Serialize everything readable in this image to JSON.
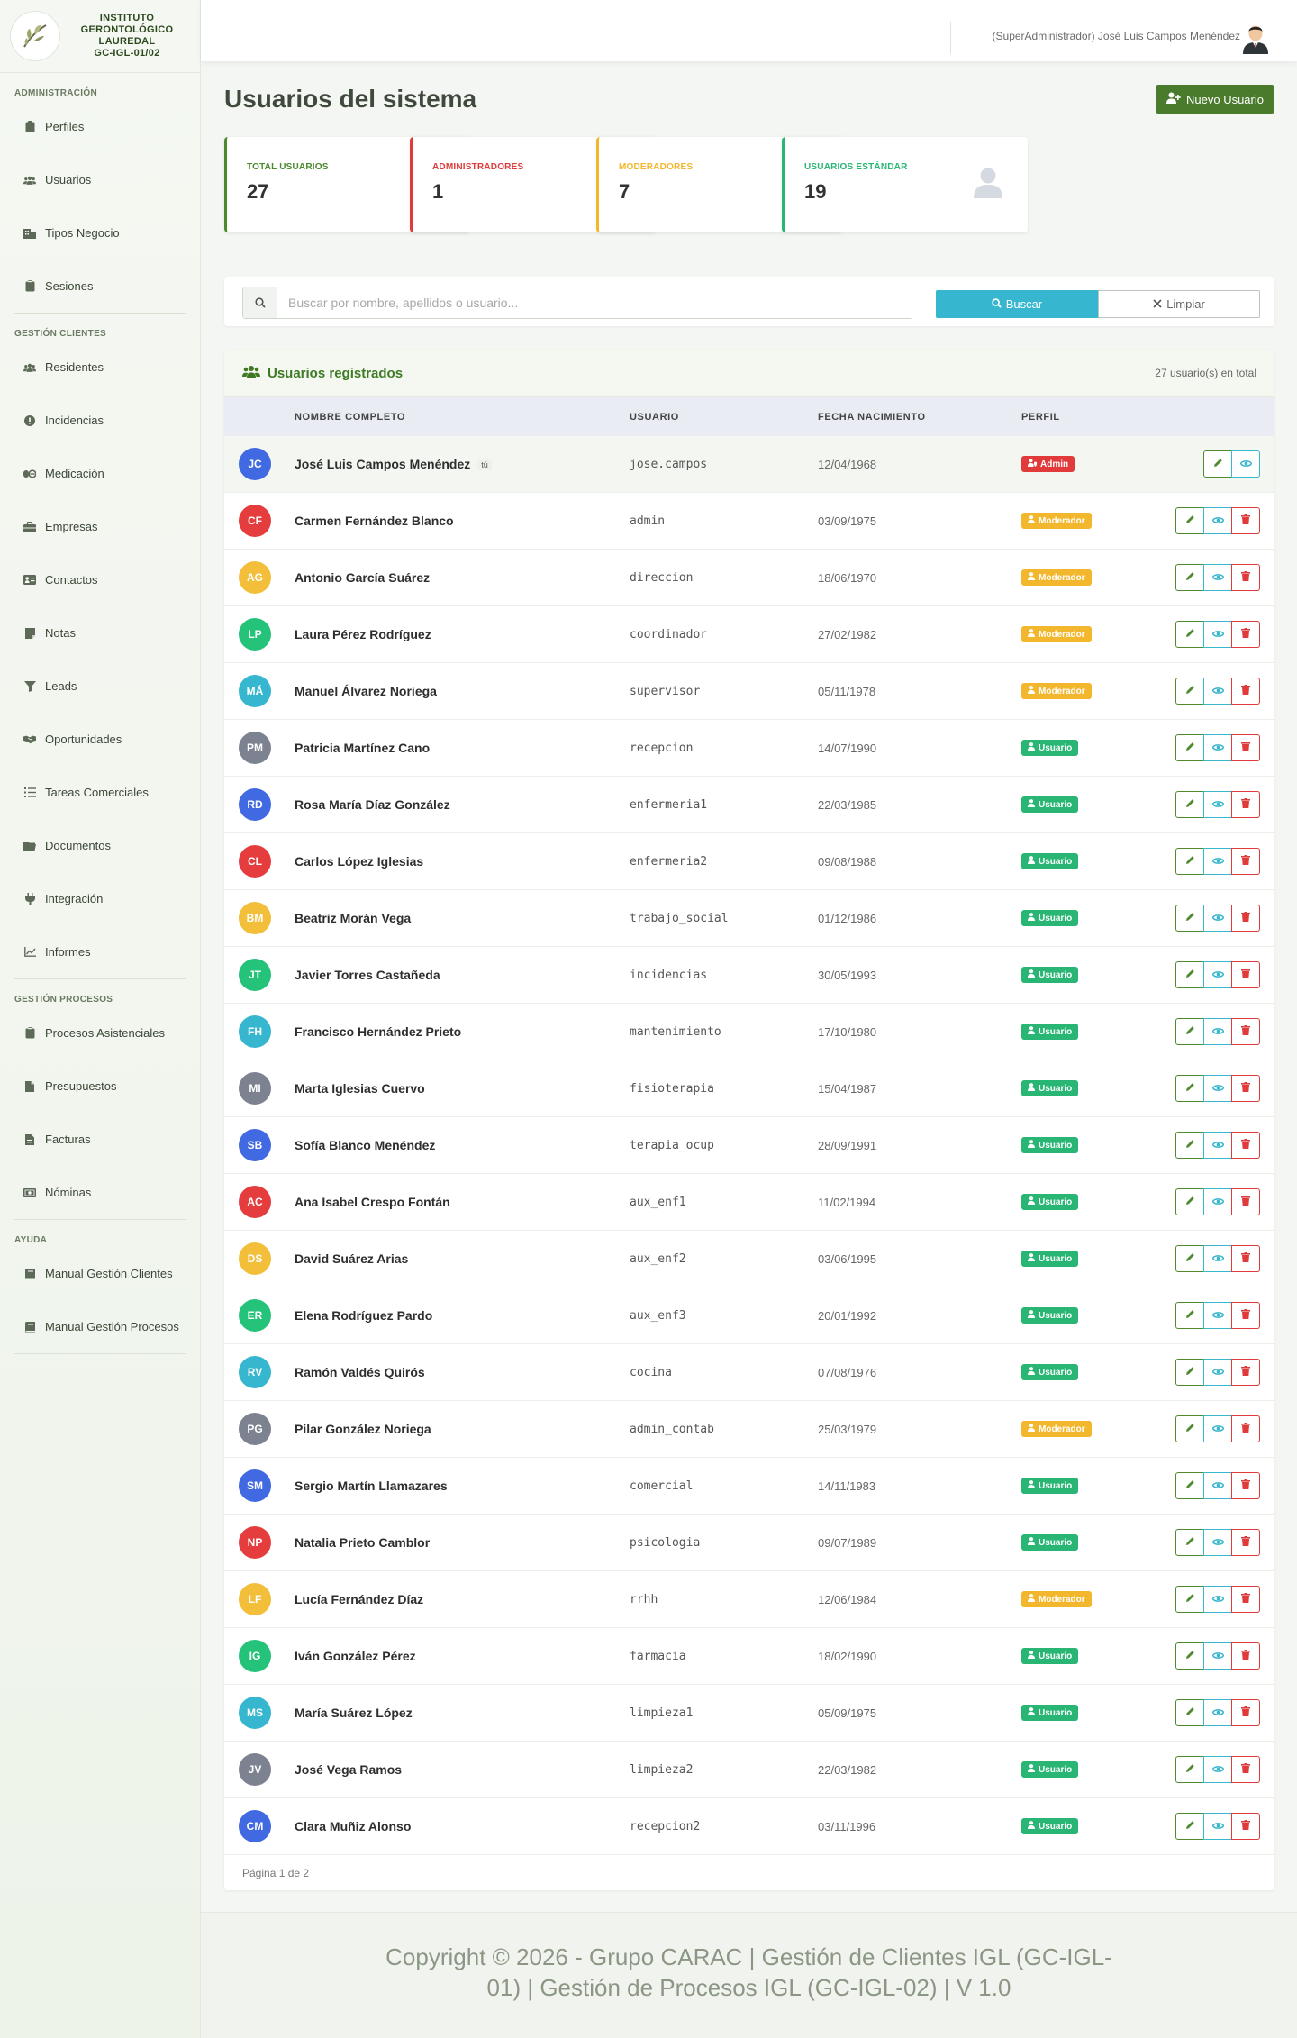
{
  "brand": {
    "line1": "INSTITUTO",
    "line2": "GERONTOLÓGICO",
    "line3": "LAUREDAL",
    "line4": "GC-IGL-01/02"
  },
  "sidebar": {
    "sections": [
      {
        "title": "ADMINISTRACIÓN",
        "items": [
          {
            "label": "Perfiles",
            "icon": "id-badge-icon"
          },
          {
            "label": "Usuarios",
            "icon": "users-icon"
          },
          {
            "label": "Tipos Negocio",
            "icon": "building-icon"
          },
          {
            "label": "Sesiones",
            "icon": "clipboard-icon"
          }
        ]
      },
      {
        "title": "GESTIÓN CLIENTES",
        "items": [
          {
            "label": "Residentes",
            "icon": "users-icon"
          },
          {
            "label": "Incidencias",
            "icon": "alert-icon"
          },
          {
            "label": "Medicación",
            "icon": "pills-icon"
          },
          {
            "label": "Empresas",
            "icon": "briefcase-icon"
          },
          {
            "label": "Contactos",
            "icon": "address-card-icon"
          },
          {
            "label": "Notas",
            "icon": "note-icon"
          },
          {
            "label": "Leads",
            "icon": "funnel-icon"
          },
          {
            "label": "Oportunidades",
            "icon": "handshake-icon"
          },
          {
            "label": "Tareas Comerciales",
            "icon": "list-icon"
          },
          {
            "label": "Documentos",
            "icon": "folder-icon"
          },
          {
            "label": "Integración",
            "icon": "plug-icon"
          },
          {
            "label": "Informes",
            "icon": "chart-icon"
          }
        ]
      },
      {
        "title": "GESTIÓN PROCESOS",
        "items": [
          {
            "label": "Procesos Asistenciales",
            "icon": "clipboard-icon"
          },
          {
            "label": "Presupuestos",
            "icon": "file-icon"
          },
          {
            "label": "Facturas",
            "icon": "invoice-icon"
          },
          {
            "label": "Nóminas",
            "icon": "money-icon"
          }
        ]
      },
      {
        "title": "AYUDA",
        "items": [
          {
            "label": "Manual Gestión Clientes",
            "icon": "book-icon"
          },
          {
            "label": "Manual Gestión Procesos",
            "icon": "book-icon"
          }
        ]
      }
    ]
  },
  "header": {
    "user": "(SuperAdministrador) José Luis Campos Menéndez"
  },
  "page": {
    "title": "Usuarios del sistema",
    "new_button": "Nuevo Usuario"
  },
  "stats": [
    {
      "label": "TOTAL USUARIOS",
      "value": "27",
      "color": "#4a8a2c",
      "icon": "users-icon"
    },
    {
      "label": "ADMINISTRADORES",
      "value": "1",
      "color": "#e03a3a",
      "icon": "user-shield-icon"
    },
    {
      "label": "MODERADORES",
      "value": "7",
      "color": "#f3b72e",
      "icon": "user-tie-icon"
    },
    {
      "label": "USUARIOS ESTÁNDAR",
      "value": "19",
      "color": "#29b675",
      "icon": "user-icon"
    }
  ],
  "search": {
    "placeholder": "Buscar por nombre, apellidos o usuario...",
    "search_button": "Buscar",
    "clear_button": "Limpiar"
  },
  "table": {
    "title": "Usuarios registrados",
    "count": "27 usuario(s) en total",
    "columns": [
      "NOMBRE COMPLETO",
      "USUARIO",
      "FECHA NACIMIENTO",
      "PERFIL"
    ],
    "you_tag": "tú",
    "rows": [
      {
        "initials": "JC",
        "color": "#4169e1",
        "name": "José Luis Campos Menéndez",
        "user": "jose.campos",
        "date": "12/04/1968",
        "profile": "Admin",
        "me": true
      },
      {
        "initials": "CF",
        "color": "#e53d3d",
        "name": "Carmen Fernández Blanco",
        "user": "admin",
        "date": "03/09/1975",
        "profile": "Moderador"
      },
      {
        "initials": "AG",
        "color": "#f3be3a",
        "name": "Antonio García Suárez",
        "user": "direccion",
        "date": "18/06/1970",
        "profile": "Moderador"
      },
      {
        "initials": "LP",
        "color": "#25c37a",
        "name": "Laura Pérez Rodríguez",
        "user": "coordinador",
        "date": "27/02/1982",
        "profile": "Moderador"
      },
      {
        "initials": "MÁ",
        "color": "#36b7cf",
        "name": "Manuel Álvarez Noriega",
        "user": "supervisor",
        "date": "05/11/1978",
        "profile": "Moderador"
      },
      {
        "initials": "PM",
        "color": "#7d8291",
        "name": "Patricia Martínez Cano",
        "user": "recepcion",
        "date": "14/07/1990",
        "profile": "Usuario"
      },
      {
        "initials": "RD",
        "color": "#4169e1",
        "name": "Rosa María Díaz González",
        "user": "enfermeria1",
        "date": "22/03/1985",
        "profile": "Usuario"
      },
      {
        "initials": "CL",
        "color": "#e53d3d",
        "name": "Carlos López Iglesias",
        "user": "enfermeria2",
        "date": "09/08/1988",
        "profile": "Usuario"
      },
      {
        "initials": "BM",
        "color": "#f3be3a",
        "name": "Beatriz Morán Vega",
        "user": "trabajo_social",
        "date": "01/12/1986",
        "profile": "Usuario"
      },
      {
        "initials": "JT",
        "color": "#25c37a",
        "name": "Javier Torres Castañeda",
        "user": "incidencias",
        "date": "30/05/1993",
        "profile": "Usuario"
      },
      {
        "initials": "FH",
        "color": "#36b7cf",
        "name": "Francisco Hernández Prieto",
        "user": "mantenimiento",
        "date": "17/10/1980",
        "profile": "Usuario"
      },
      {
        "initials": "MI",
        "color": "#7d8291",
        "name": "Marta Iglesias Cuervo",
        "user": "fisioterapia",
        "date": "15/04/1987",
        "profile": "Usuario"
      },
      {
        "initials": "SB",
        "color": "#4169e1",
        "name": "Sofía Blanco Menéndez",
        "user": "terapia_ocup",
        "date": "28/09/1991",
        "profile": "Usuario"
      },
      {
        "initials": "AC",
        "color": "#e53d3d",
        "name": "Ana Isabel Crespo Fontán",
        "user": "aux_enf1",
        "date": "11/02/1994",
        "profile": "Usuario"
      },
      {
        "initials": "DS",
        "color": "#f3be3a",
        "name": "David Suárez Arias",
        "user": "aux_enf2",
        "date": "03/06/1995",
        "profile": "Usuario"
      },
      {
        "initials": "ER",
        "color": "#25c37a",
        "name": "Elena Rodríguez Pardo",
        "user": "aux_enf3",
        "date": "20/01/1992",
        "profile": "Usuario"
      },
      {
        "initials": "RV",
        "color": "#36b7cf",
        "name": "Ramón Valdés Quirós",
        "user": "cocina",
        "date": "07/08/1976",
        "profile": "Usuario"
      },
      {
        "initials": "PG",
        "color": "#7d8291",
        "name": "Pilar González Noriega",
        "user": "admin_contab",
        "date": "25/03/1979",
        "profile": "Moderador"
      },
      {
        "initials": "SM",
        "color": "#4169e1",
        "name": "Sergio Martín Llamazares",
        "user": "comercial",
        "date": "14/11/1983",
        "profile": "Usuario"
      },
      {
        "initials": "NP",
        "color": "#e53d3d",
        "name": "Natalia Prieto Camblor",
        "user": "psicologia",
        "date": "09/07/1989",
        "profile": "Usuario"
      },
      {
        "initials": "LF",
        "color": "#f3be3a",
        "name": "Lucía Fernández Díaz",
        "user": "rrhh",
        "date": "12/06/1984",
        "profile": "Moderador"
      },
      {
        "initials": "IG",
        "color": "#25c37a",
        "name": "Iván González Pérez",
        "user": "farmacia",
        "date": "18/02/1990",
        "profile": "Usuario"
      },
      {
        "initials": "MS",
        "color": "#36b7cf",
        "name": "María Suárez López",
        "user": "limpieza1",
        "date": "05/09/1975",
        "profile": "Usuario"
      },
      {
        "initials": "JV",
        "color": "#7d8291",
        "name": "José Vega Ramos",
        "user": "limpieza2",
        "date": "22/03/1982",
        "profile": "Usuario"
      },
      {
        "initials": "CM",
        "color": "#4169e1",
        "name": "Clara Muñiz Alonso",
        "user": "recepcion2",
        "date": "03/11/1996",
        "profile": "Usuario"
      }
    ],
    "pagination": "Página 1 de 2"
  },
  "footer": {
    "text": "Copyright © 2026 - Grupo CARAC | Gestión de Clientes IGL (GC-IGL-01) | Gestión de Procesos IGL (GC-IGL-02) | V 1.0"
  }
}
